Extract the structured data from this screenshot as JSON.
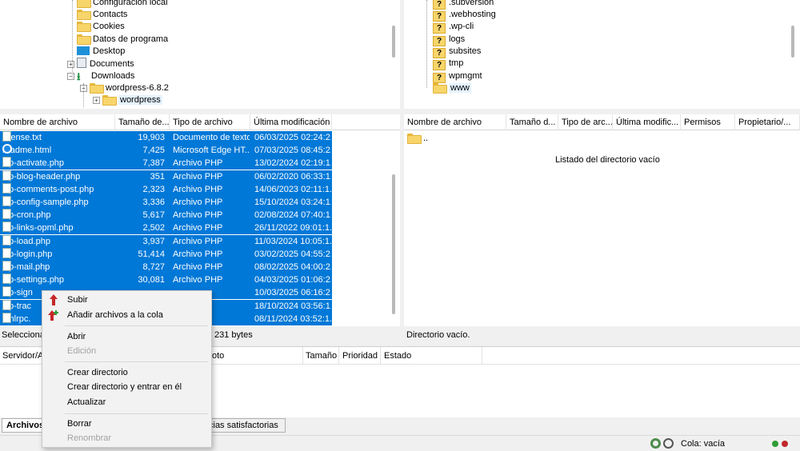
{
  "local_tree": {
    "items": [
      {
        "label": "Configuración local"
      },
      {
        "label": "Contacts"
      },
      {
        "label": "Cookies"
      },
      {
        "label": "Datos de programa"
      },
      {
        "label": "Desktop"
      },
      {
        "label": "Documents"
      },
      {
        "label": "Downloads"
      },
      {
        "label": "wordpress-6.8.2"
      },
      {
        "label": "wordpress"
      }
    ]
  },
  "remote_tree": {
    "items": [
      {
        "label": ".subversion"
      },
      {
        "label": ".webhosting"
      },
      {
        "label": ".wp-cli"
      },
      {
        "label": "logs"
      },
      {
        "label": "subsites"
      },
      {
        "label": "tmp"
      },
      {
        "label": "wpmgmt"
      },
      {
        "label": "www"
      }
    ]
  },
  "local_list": {
    "columns": [
      "Nombre de archivo",
      "Tamaño de...",
      "Tipo de archivo",
      "Última modificación"
    ],
    "rows": [
      {
        "name": "license.txt",
        "size": "19,903",
        "type": "Documento de texto",
        "modified": "06/03/2025 02:24:2..."
      },
      {
        "name": "readme.html",
        "size": "7,425",
        "type": "Microsoft Edge HT...",
        "modified": "07/03/2025 08:45:2..."
      },
      {
        "name": "wp-activate.php",
        "size": "7,387",
        "type": "Archivo PHP",
        "modified": "13/02/2024 02:19:1..."
      },
      {
        "name": "wp-blog-header.php",
        "size": "351",
        "type": "Archivo PHP",
        "modified": "06/02/2020 06:33:1..."
      },
      {
        "name": "wp-comments-post.php",
        "size": "2,323",
        "type": "Archivo PHP",
        "modified": "14/06/2023 02:11:1..."
      },
      {
        "name": "wp-config-sample.php",
        "size": "3,336",
        "type": "Archivo PHP",
        "modified": "15/10/2024 03:24:1..."
      },
      {
        "name": "wp-cron.php",
        "size": "5,617",
        "type": "Archivo PHP",
        "modified": "02/08/2024 07:40:1..."
      },
      {
        "name": "wp-links-opml.php",
        "size": "2,502",
        "type": "Archivo PHP",
        "modified": "26/11/2022 09:01:1..."
      },
      {
        "name": "wp-load.php",
        "size": "3,937",
        "type": "Archivo PHP",
        "modified": "11/03/2024 10:05:1..."
      },
      {
        "name": "wp-login.php",
        "size": "51,414",
        "type": "Archivo PHP",
        "modified": "03/02/2025 04:55:2..."
      },
      {
        "name": "wp-mail.php",
        "size": "8,727",
        "type": "Archivo PHP",
        "modified": "08/02/2025 04:00:2..."
      },
      {
        "name": "wp-settings.php",
        "size": "30,081",
        "type": "Archivo PHP",
        "modified": "04/03/2025 01:06:2..."
      },
      {
        "name": "wp-sign",
        "size": "",
        "type": "",
        "modified": "10/03/2025 06:16:2..."
      },
      {
        "name": "wp-trac",
        "size": "",
        "type": "",
        "modified": "18/10/2024 03:56:1..."
      },
      {
        "name": "xmlrpc.",
        "size": "",
        "type": "",
        "modified": "08/11/2024 03:52:1..."
      }
    ],
    "status": "Seleccionac",
    "status_bytes": "231 bytes"
  },
  "remote_list": {
    "columns": [
      "Nombre de archivo",
      "Tamaño d...",
      "Tipo de arc...",
      "Última modific...",
      "Permisos",
      "Propietario/..."
    ],
    "parent_label": "..",
    "empty_message": "Listado del directorio vacío",
    "status": "Directorio vacío."
  },
  "queue": {
    "columns": [
      "Servidor/A",
      "oto",
      "Tamaño",
      "Prioridad",
      "Estado"
    ],
    "tabs": [
      "Archivos",
      "cias satisfactorias"
    ]
  },
  "context_menu": {
    "upload": "Subir",
    "add_to_queue": "Añadir archivos a la cola",
    "open": "Abrir",
    "edit": "Edición",
    "create_dir": "Crear directorio",
    "create_dir_enter": "Crear directorio y entrar en él",
    "refresh": "Actualizar",
    "delete": "Borrar",
    "rename": "Renombrar"
  },
  "statusbar": {
    "queue": "Cola: vacía"
  },
  "colors": {
    "selection": "#0078d7",
    "upload_arrow": "#c62828",
    "add_arrow": "#2e9d3a"
  }
}
